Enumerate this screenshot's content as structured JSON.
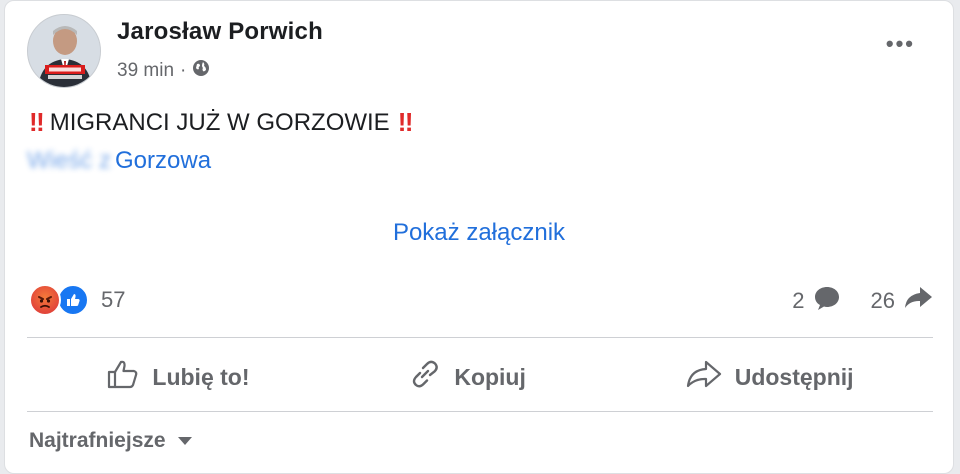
{
  "post": {
    "author": "Jarosław Porwich",
    "time": "39 min",
    "separator": "·",
    "privacy_icon": "globe-icon",
    "more_label": "•••",
    "bang": "‼",
    "text": "MIGRANCI JUŻ W GORZOWIE",
    "link_blurred": "Wieść z",
    "link_visible": "Gorzowa",
    "attachment_label": "Pokaż załącznik"
  },
  "reactions": {
    "icons": [
      "angry-icon",
      "like-icon"
    ],
    "count": "57",
    "comments_count": "2",
    "shares_count": "26"
  },
  "actions": {
    "like": "Lubię to!",
    "copy": "Kopiuj",
    "share": "Udostępnij"
  },
  "sort": {
    "label": "Najtrafniejsze"
  },
  "colors": {
    "link": "#216fdb",
    "text": "#1c1e21",
    "muted": "#65676b",
    "alert": "#e02a2a",
    "like_blue": "#1877f2"
  }
}
